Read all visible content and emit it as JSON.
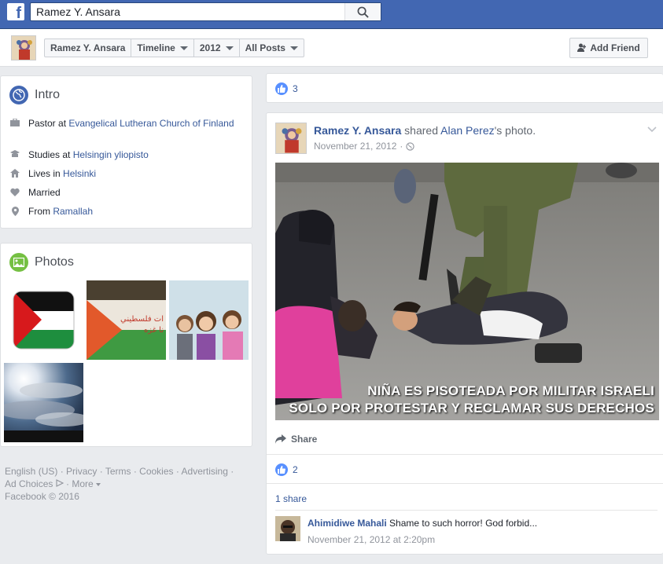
{
  "search": {
    "value": "Ramez Y. Ansara"
  },
  "nav": {
    "crumbs": [
      "Ramez Y. Ansara",
      "Timeline",
      "2012",
      "All Posts"
    ],
    "add_friend": "Add Friend"
  },
  "intro": {
    "title": "Intro",
    "work_prefix": "Pastor at ",
    "work_link": "Evangelical Lutheran Church of Finland",
    "study_prefix": "Studies at ",
    "study_link": "Helsingin yliopisto",
    "lives_prefix": "Lives in ",
    "lives_link": "Helsinki",
    "relationship": "Married",
    "from_prefix": "From ",
    "from_link": "Ramallah"
  },
  "photos": {
    "title": "Photos",
    "banner_text": "ات فلسطيني\nنا غزه"
  },
  "footer": {
    "links": [
      "English (US)",
      "Privacy",
      "Terms",
      "Cookies",
      "Advertising",
      "Ad Choices",
      "More"
    ],
    "copyright": "Facebook © 2016"
  },
  "prev_post": {
    "like_count": "3"
  },
  "post": {
    "author": "Ramez Y. Ansara",
    "action": " shared ",
    "source": "Alan Perez",
    "object": "'s photo.",
    "date": "November 21, 2012",
    "photo_caption_1": "NIÑA ES PISOTEADA POR MILITAR ISRAELI",
    "photo_caption_2": "SOLO POR PROTESTAR Y RECLAMAR SUS DERECHOS",
    "share_label": "Share",
    "like_count": "2",
    "shares": "1 share",
    "comment": {
      "author": "Ahimidiwe Mahali",
      "text": "Shame to such horror! God forbid...",
      "time": "November 21, 2012 at 2:20pm"
    }
  },
  "colors": {
    "brand": "#4267b2",
    "link": "#365899",
    "like": "#5890ff"
  }
}
